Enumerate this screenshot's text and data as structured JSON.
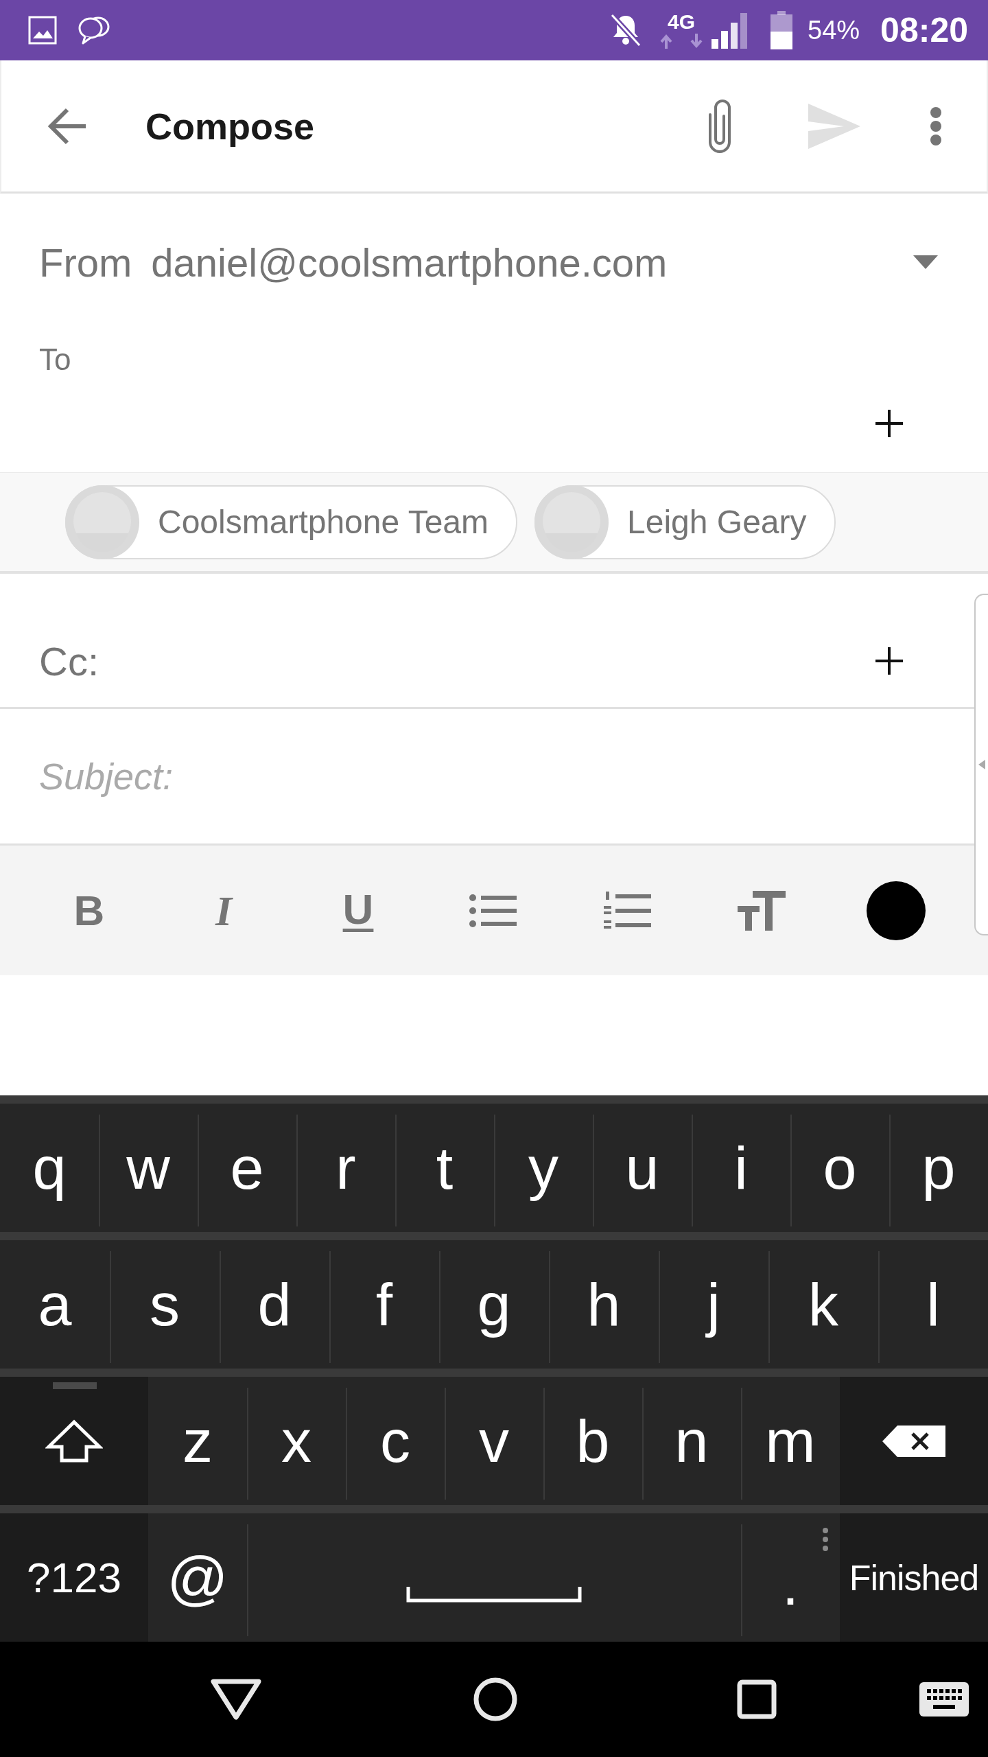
{
  "status_bar": {
    "network": "4G",
    "battery": "54%",
    "time": "08:20"
  },
  "toolbar": {
    "title": "Compose",
    "actions": [
      {
        "kind": "attach",
        "disabled": false
      },
      {
        "kind": "send",
        "disabled": true
      },
      {
        "kind": "more",
        "disabled": false
      }
    ]
  },
  "from": {
    "label": "From",
    "value": "daniel@coolsmartphone.com"
  },
  "to": {
    "label": "To",
    "recipients": [
      {
        "name": "Coolsmartphone Team"
      },
      {
        "name": "Leigh Geary"
      }
    ]
  },
  "cc": {
    "label": "Cc:"
  },
  "subject": {
    "placeholder": "Subject:"
  },
  "formatting": [
    {
      "kind": "bold",
      "label": "B"
    },
    {
      "kind": "italic",
      "label": "I"
    },
    {
      "kind": "underline",
      "label": "U"
    },
    {
      "kind": "bullet-list"
    },
    {
      "kind": "numbered-list"
    },
    {
      "kind": "text-size"
    },
    {
      "kind": "color",
      "color": "#000000"
    }
  ],
  "keyboard": {
    "rows": [
      {
        "keys": [
          {
            "kind": "letter",
            "label": "q"
          },
          {
            "kind": "letter",
            "label": "w"
          },
          {
            "kind": "letter",
            "label": "e"
          },
          {
            "kind": "letter",
            "label": "r"
          },
          {
            "kind": "letter",
            "label": "t"
          },
          {
            "kind": "letter",
            "label": "y"
          },
          {
            "kind": "letter",
            "label": "u"
          },
          {
            "kind": "letter",
            "label": "i"
          },
          {
            "kind": "letter",
            "label": "o"
          },
          {
            "kind": "letter",
            "label": "p"
          }
        ]
      },
      {
        "keys": [
          {
            "kind": "letter",
            "label": "a"
          },
          {
            "kind": "letter",
            "label": "s"
          },
          {
            "kind": "letter",
            "label": "d"
          },
          {
            "kind": "letter",
            "label": "f"
          },
          {
            "kind": "letter",
            "label": "g"
          },
          {
            "kind": "letter",
            "label": "h"
          },
          {
            "kind": "letter",
            "label": "j"
          },
          {
            "kind": "letter",
            "label": "k"
          },
          {
            "kind": "letter",
            "label": "l"
          }
        ]
      },
      {
        "keys": [
          {
            "kind": "shift",
            "locked": false
          },
          {
            "kind": "letter",
            "label": "z"
          },
          {
            "kind": "letter",
            "label": "x"
          },
          {
            "kind": "letter",
            "label": "c"
          },
          {
            "kind": "letter",
            "label": "v"
          },
          {
            "kind": "letter",
            "label": "b"
          },
          {
            "kind": "letter",
            "label": "n"
          },
          {
            "kind": "letter",
            "label": "m"
          },
          {
            "kind": "backspace"
          }
        ]
      },
      {
        "keys": [
          {
            "kind": "mode",
            "label": "?123"
          },
          {
            "kind": "letter",
            "label": "@"
          },
          {
            "kind": "space"
          },
          {
            "kind": "period",
            "label": "."
          },
          {
            "kind": "action",
            "label": "Finished"
          }
        ]
      }
    ]
  }
}
